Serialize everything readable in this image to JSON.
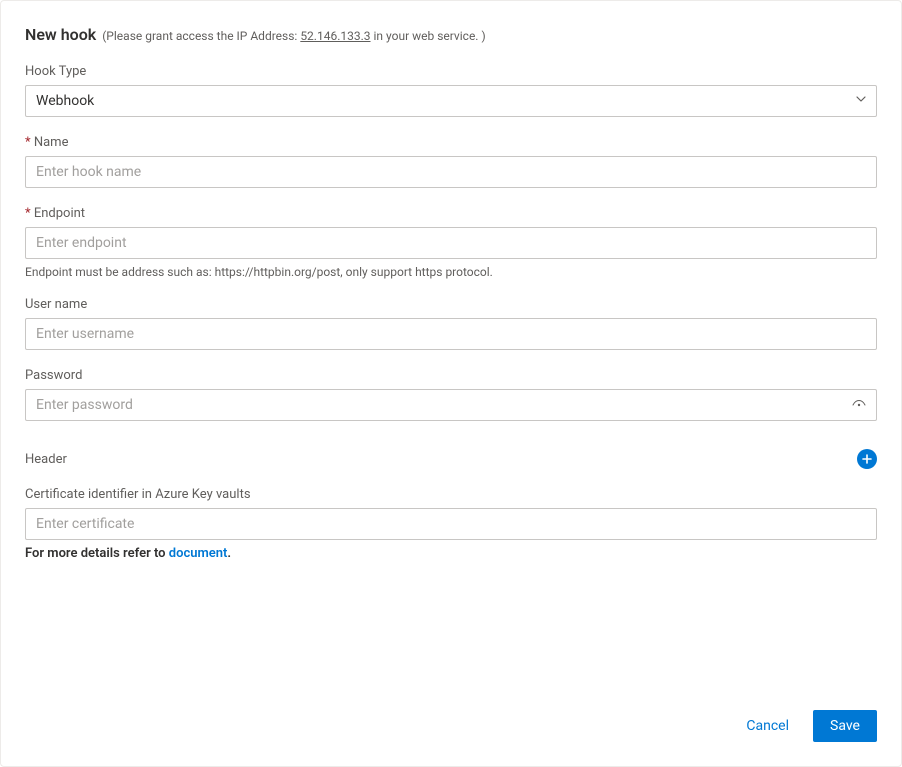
{
  "header": {
    "title": "New hook",
    "subtitle_prefix": "(Please grant access the IP Address: ",
    "ip": "52.146.133.3",
    "subtitle_suffix": " in your web service. )"
  },
  "fields": {
    "hook_type": {
      "label": "Hook Type",
      "value": "Webhook"
    },
    "name": {
      "label": "Name",
      "placeholder": "Enter hook name",
      "value": ""
    },
    "endpoint": {
      "label": "Endpoint",
      "placeholder": "Enter endpoint",
      "value": "",
      "helper": "Endpoint must be address such as: https://httpbin.org/post, only support https protocol."
    },
    "username": {
      "label": "User name",
      "placeholder": "Enter username",
      "value": ""
    },
    "password": {
      "label": "Password",
      "placeholder": "Enter password",
      "value": ""
    },
    "header_section": {
      "label": "Header"
    },
    "certificate": {
      "label": "Certificate identifier in Azure Key vaults",
      "placeholder": "Enter certificate",
      "value": ""
    }
  },
  "details": {
    "prefix": "For more details refer to ",
    "link_text": "document",
    "suffix": "."
  },
  "footer": {
    "cancel": "Cancel",
    "save": "Save"
  }
}
